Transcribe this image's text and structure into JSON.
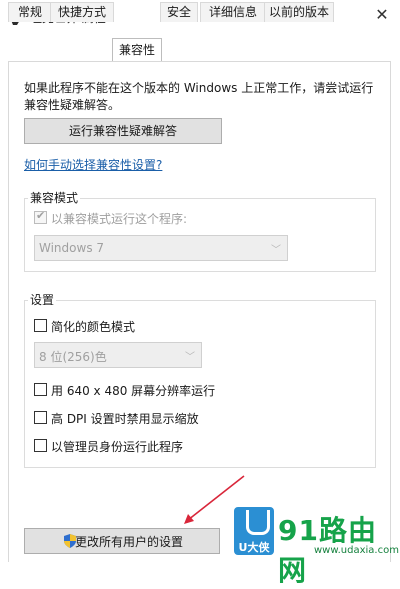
{
  "window": {
    "title": "坦克世界 属性",
    "close_glyph": "✕",
    "icon": "app-icon"
  },
  "tabs": [
    {
      "label": "常规",
      "active": false
    },
    {
      "label": "快捷方式",
      "active": false
    },
    {
      "label": "兼容性",
      "active": true
    },
    {
      "label": "安全",
      "active": false
    },
    {
      "label": "详细信息",
      "active": false
    },
    {
      "label": "以前的版本",
      "active": false
    }
  ],
  "compat": {
    "intro_text": "如果此程序不能在这个版本的 Windows 上正常工作，请尝试运行兼容性疑难解答。",
    "troubleshooter_button": "运行兼容性疑难解答",
    "manual_link": "如何手动选择兼容性设置?",
    "mode_group": {
      "label": "兼容模式",
      "checkbox_label": "以兼容模式运行这个程序:",
      "checked": true,
      "select_value": "Windows 7"
    },
    "settings_group": {
      "label": "设置",
      "reduced_color": "简化的颜色模式",
      "color_select_value": "8 位(256)色",
      "run_640": "用 640 x 480 屏幕分辨率运行",
      "disable_dpi": "高 DPI 设置时禁用显示缩放",
      "run_admin": "以管理员身份运行此程序"
    },
    "change_all_users_button": "更改所有用户的设置"
  },
  "watermark": {
    "brand_small": "U大侠",
    "brand_big": "91路由网",
    "url": "www.udaxia.com"
  },
  "colors": {
    "link": "#1a5ea8",
    "accent_green": "#16a34a",
    "watermark_blue": "#2b8fd3",
    "annotation_arrow": "#d9263a"
  }
}
